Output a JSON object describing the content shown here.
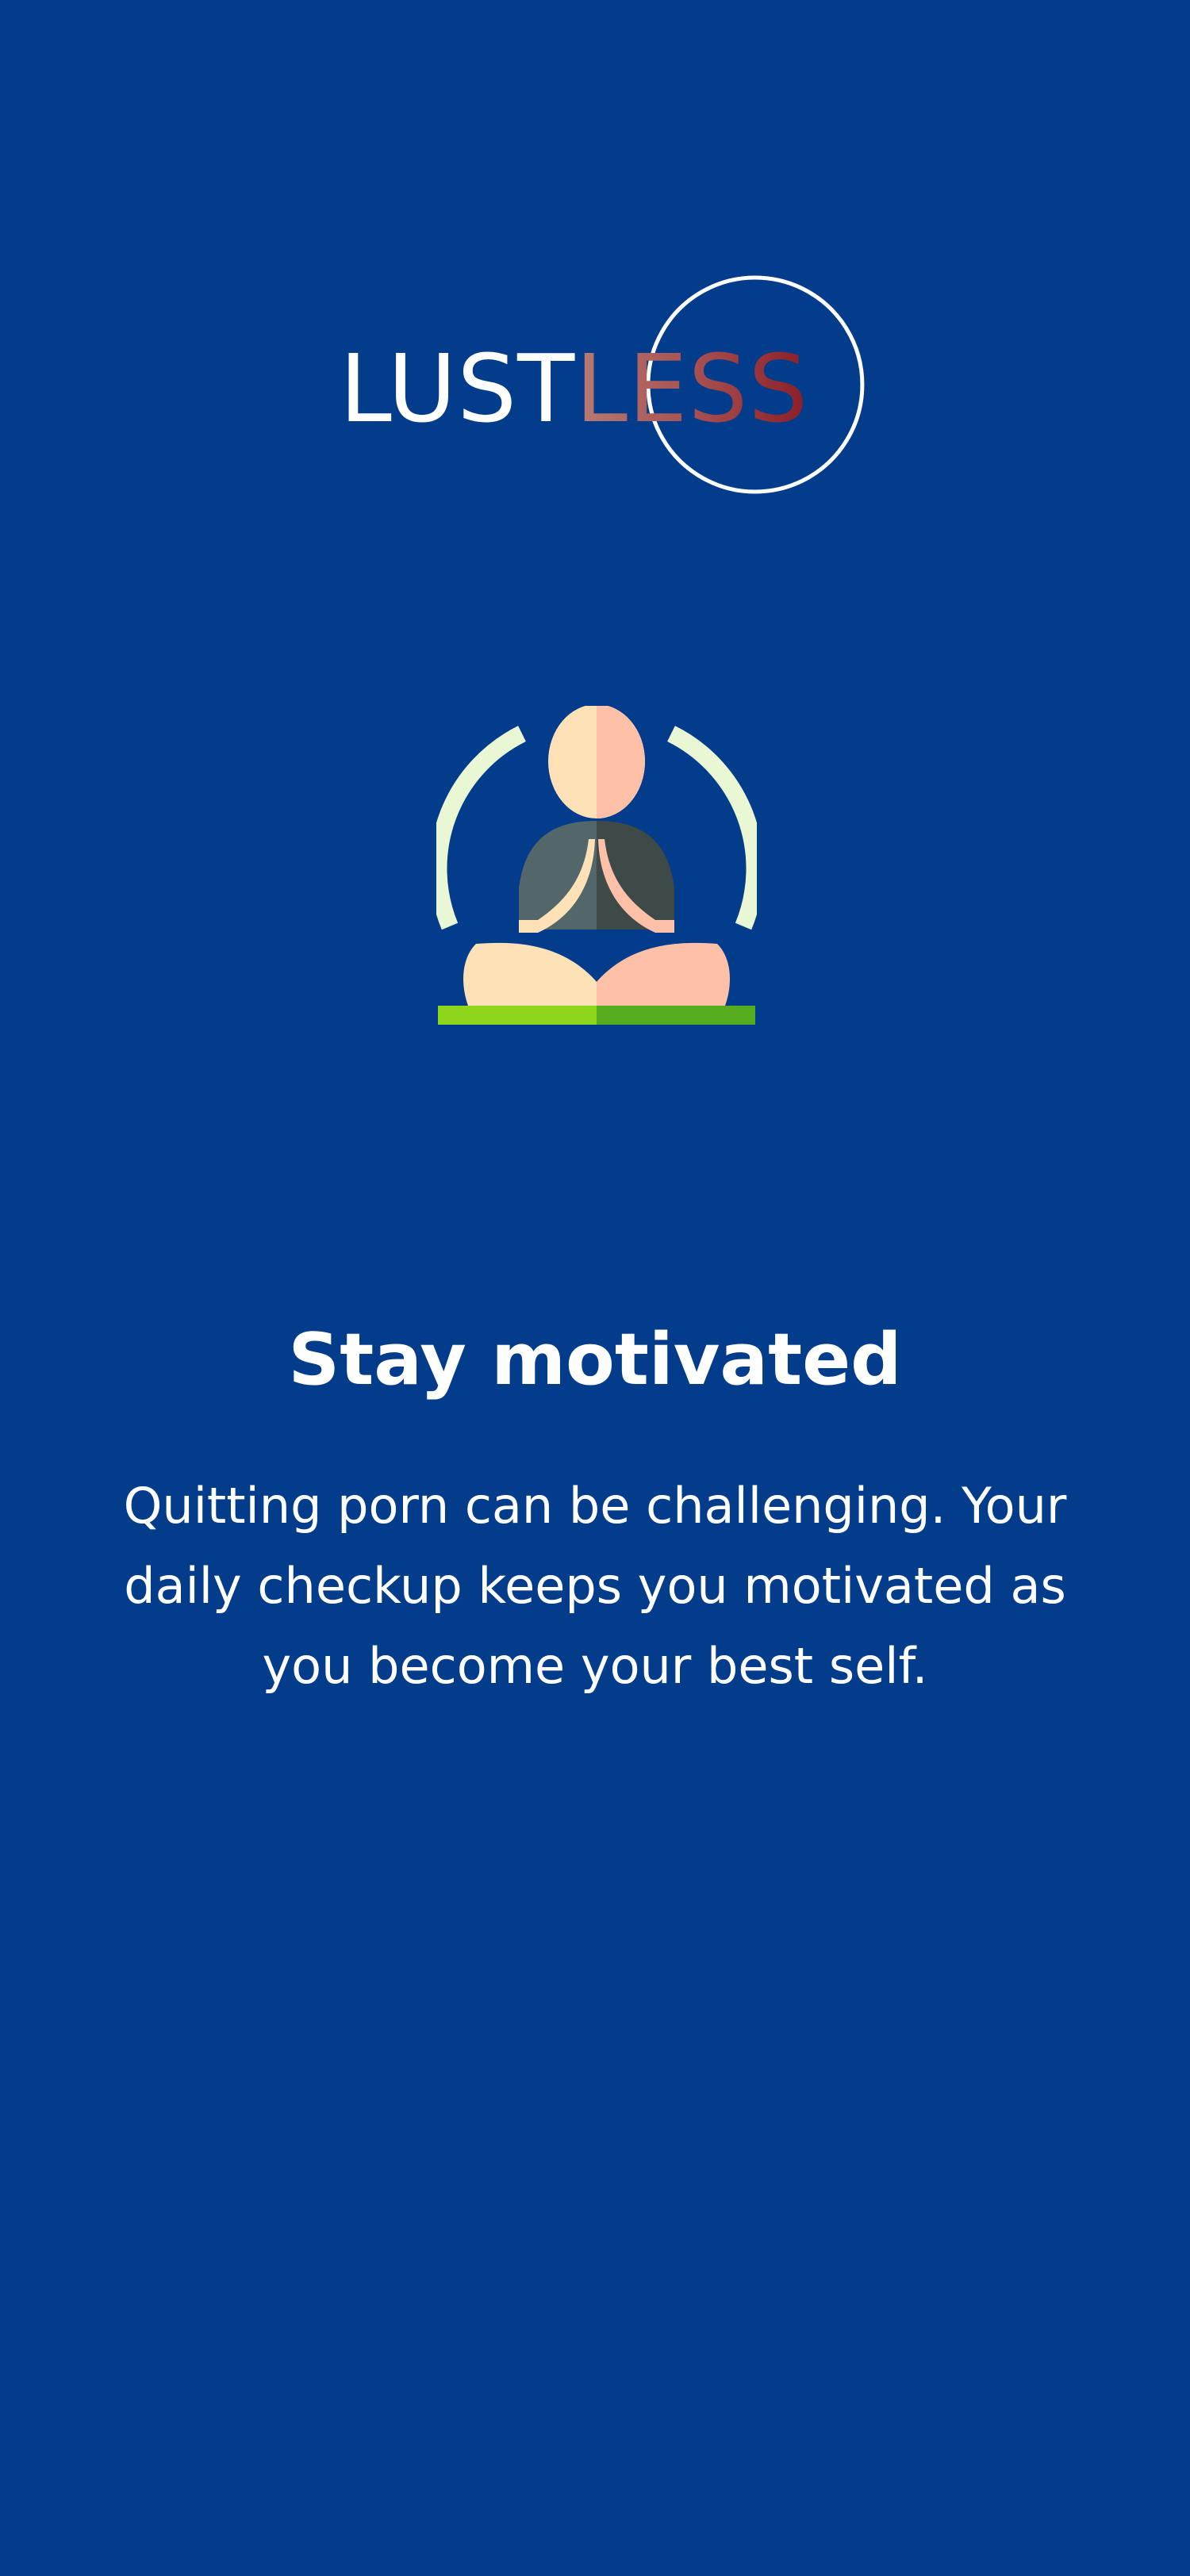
{
  "screen": {
    "background_color": "#033C8B"
  },
  "logo": {
    "part1": "LUST",
    "part2": "LESS",
    "part1_color": "#FFFFFF",
    "part2_colors": [
      "#B97B74",
      "#A54D4E",
      "#8A1E27"
    ],
    "ring_color": "#FFFFFF"
  },
  "illustration": {
    "icon": "meditation-figure-icon",
    "colors": {
      "arc": "#E9F7D4",
      "skin_light": "#FFE1B8",
      "skin_shade": "#FFC0A8",
      "body_light": "#53676A",
      "body_dark": "#3D4A48",
      "mat_light": "#8ED61B",
      "mat_dark": "#55AC1F"
    }
  },
  "headline": "Stay motivated",
  "description": "Quitting porn can be challenging. Your daily checkup keeps you motivated as you become your best self."
}
